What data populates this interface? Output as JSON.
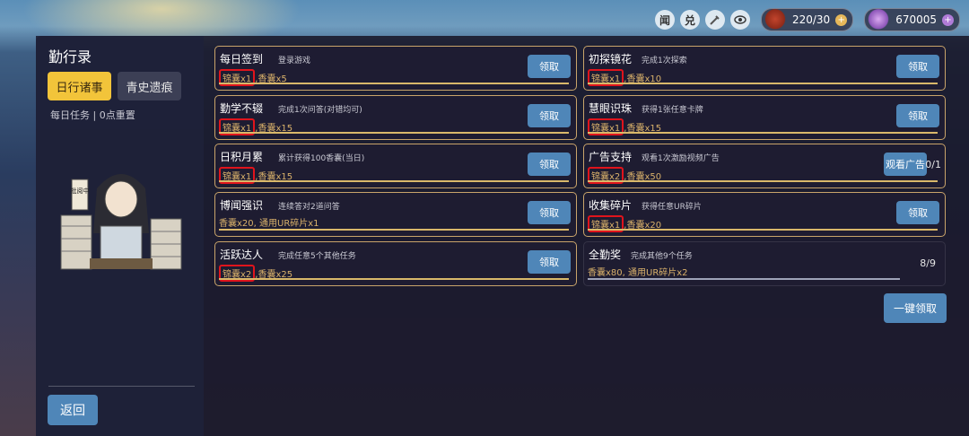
{
  "topbar": {
    "btn1": "闻",
    "btn2": "兑",
    "res1_value": "220/30",
    "res2_value": "670005",
    "colors": {
      "coin_plus": "#e6b85a",
      "gem_plus": "#b07cd8"
    }
  },
  "sidebar": {
    "title": "勤行录",
    "tabs": [
      "日行诸事",
      "青史遗痕"
    ],
    "note": "每日任务 | 0点重置",
    "figure_sign": "批阅中",
    "back_label": "返回"
  },
  "tasks_left": [
    {
      "title": "每日签到",
      "desc": "登录游戏",
      "reward_hl": "锦囊x1",
      "reward_rest": ",香囊x5",
      "button": "领取"
    },
    {
      "title": "勤学不辍",
      "desc": "完成1次问答(对错均可)",
      "reward_hl": "锦囊x1",
      "reward_rest": ",香囊x15",
      "button": "领取"
    },
    {
      "title": "日积月累",
      "desc": "累计获得100香囊(当日)",
      "reward_hl": "锦囊x1",
      "reward_rest": ",香囊x15",
      "button": "领取"
    },
    {
      "title": "博闻强识",
      "desc": "连续答对2道问答",
      "reward_hl": "",
      "reward_rest": "香囊x20, 通用UR碎片x1",
      "button": "领取"
    },
    {
      "title": "活跃达人",
      "desc": "完成任意5个其他任务",
      "reward_hl": "锦囊x2",
      "reward_rest": ",香囊x25",
      "button": "领取"
    }
  ],
  "tasks_right": [
    {
      "title": "初探镜花",
      "desc": "完成1次探索",
      "reward_hl": "锦囊x1",
      "reward_rest": ",香囊x10",
      "button": "领取"
    },
    {
      "title": "慧眼识珠",
      "desc": "获得1张任意卡牌",
      "reward_hl": "锦囊x1",
      "reward_rest": ",香囊x15",
      "button": "领取"
    },
    {
      "title": "广告支持",
      "desc": "观看1次激励视频广告",
      "reward_hl": "锦囊x2",
      "reward_rest": ",香囊x50",
      "button": "观看广告",
      "progress": "0/1"
    },
    {
      "title": "收集碎片",
      "desc": "获得任意UR碎片",
      "reward_hl": "锦囊x1",
      "reward_rest": ",香囊x20",
      "button": "领取"
    },
    {
      "title": "全勤奖",
      "desc": "完成其他9个任务",
      "reward_hl": "",
      "reward_rest": "香囊x80, 通用UR碎片x2",
      "progress": "8/9",
      "progress_fraction": 0.89
    }
  ],
  "claim_all_label": "一键领取"
}
